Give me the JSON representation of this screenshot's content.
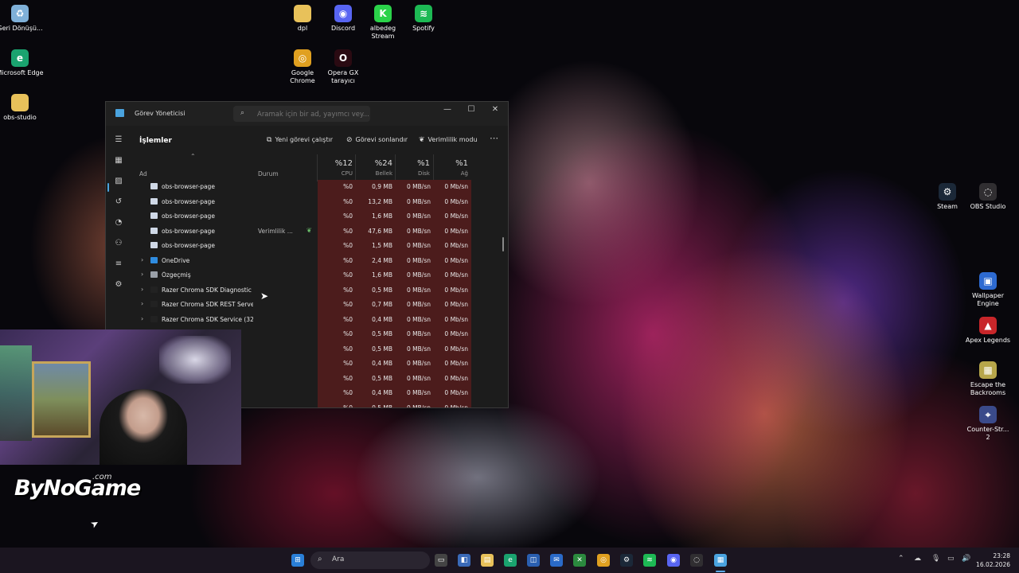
{
  "desktop": {
    "icons_left": [
      {
        "label": "Geri Dönüşü...",
        "icon": "recycle-bin-icon",
        "color": "#7fb0d8",
        "glyph": "♻"
      },
      {
        "label": "Microsoft Edge",
        "icon": "edge-icon",
        "color": "#1aa36f",
        "glyph": "e"
      },
      {
        "label": "obs-studio",
        "icon": "folder-icon",
        "color": "#e8c15a",
        "glyph": ""
      }
    ],
    "icons_top": [
      {
        "label": "dpl",
        "icon": "folder-icon",
        "color": "#e8c15a",
        "glyph": ""
      },
      {
        "label": "Discord",
        "icon": "discord-icon",
        "color": "#5865f2",
        "glyph": "◉"
      },
      {
        "label": "albedeg Stream",
        "icon": "kick-icon",
        "color": "#2bd34a",
        "glyph": "K"
      },
      {
        "label": "Spotify",
        "icon": "spotify-icon",
        "color": "#1db954",
        "glyph": "≋"
      },
      {
        "label": "Google Chrome",
        "icon": "chrome-icon",
        "color": "#e0a020",
        "glyph": "◎"
      },
      {
        "label": "Opera GX tarayıcı",
        "icon": "opera-gx-icon",
        "color": "#2a0a12",
        "glyph": "O"
      }
    ],
    "icons_right": [
      {
        "label": "Steam",
        "icon": "steam-icon",
        "color": "#1b2838",
        "glyph": "⚙"
      },
      {
        "label": "OBS Studio",
        "icon": "obs-icon",
        "color": "#302e31",
        "glyph": "◌"
      },
      {
        "label": "Wallpaper Engine",
        "icon": "wallpaper-engine-icon",
        "color": "#2d6ad1",
        "glyph": "▣"
      },
      {
        "label": "Apex Legends",
        "icon": "apex-icon",
        "color": "#c8262a",
        "glyph": "▲"
      },
      {
        "label": "Escape the Backrooms",
        "icon": "backrooms-icon",
        "color": "#b7a64a",
        "glyph": "▦"
      },
      {
        "label": "Counter-Str... 2",
        "icon": "cs2-icon",
        "color": "#3a4a8a",
        "glyph": "⌖"
      }
    ]
  },
  "task_manager": {
    "title": "Görev Yöneticisi",
    "search_placeholder": "Aramak için bir ad, yayımcı vey...",
    "page_title": "İşlemler",
    "toolbar": {
      "run_new_task": "Yeni görevi çalıştır",
      "end_task": "Görevi sonlandır",
      "efficiency_mode": "Verimlilik modu",
      "more": "⋯"
    },
    "columns": {
      "name": "Ad",
      "status": "Durum",
      "cpu_pct": "%12",
      "cpu": "CPU",
      "mem_pct": "%24",
      "mem": "Bellek",
      "disk_pct": "%1",
      "disk": "Disk",
      "net_pct": "%1",
      "net": "Ağ"
    },
    "rows": [
      {
        "name": "obs-browser-page",
        "expand": "",
        "status": "",
        "leaf": false,
        "cpu": "%0",
        "mem": "0,9 MB",
        "disk": "0 MB/sn",
        "net": "0 Mb/sn",
        "icon_color": "#cfd8e6"
      },
      {
        "name": "obs-browser-page",
        "expand": "",
        "status": "",
        "leaf": false,
        "cpu": "%0",
        "mem": "13,2 MB",
        "disk": "0 MB/sn",
        "net": "0 Mb/sn",
        "icon_color": "#cfd8e6"
      },
      {
        "name": "obs-browser-page",
        "expand": "",
        "status": "",
        "leaf": false,
        "cpu": "%0",
        "mem": "1,6 MB",
        "disk": "0 MB/sn",
        "net": "0 Mb/sn",
        "icon_color": "#cfd8e6"
      },
      {
        "name": "obs-browser-page",
        "expand": "",
        "status": "Verimlilik ...",
        "leaf": true,
        "cpu": "%0",
        "mem": "47,6 MB",
        "disk": "0 MB/sn",
        "net": "0 Mb/sn",
        "icon_color": "#cfd8e6"
      },
      {
        "name": "obs-browser-page",
        "expand": "",
        "status": "",
        "leaf": false,
        "cpu": "%0",
        "mem": "1,5 MB",
        "disk": "0 MB/sn",
        "net": "0 Mb/sn",
        "icon_color": "#cfd8e6"
      },
      {
        "name": "OneDrive",
        "expand": "›",
        "status": "",
        "leaf": false,
        "cpu": "%0",
        "mem": "2,4 MB",
        "disk": "0 MB/sn",
        "net": "0 Mb/sn",
        "icon_color": "#2f8ce0"
      },
      {
        "name": "Özgeçmiş",
        "expand": "›",
        "status": "",
        "leaf": false,
        "cpu": "%0",
        "mem": "1,6 MB",
        "disk": "0 MB/sn",
        "net": "0 Mb/sn",
        "icon_color": "#9aa0a8"
      },
      {
        "name": "Razer Chroma SDK Diagnostic ...",
        "expand": "›",
        "status": "",
        "leaf": false,
        "cpu": "%0",
        "mem": "0,5 MB",
        "disk": "0 MB/sn",
        "net": "0 Mb/sn",
        "icon_color": "#222"
      },
      {
        "name": "Razer Chroma SDK REST Serve...",
        "expand": "›",
        "status": "",
        "leaf": false,
        "cpu": "%0",
        "mem": "0,7 MB",
        "disk": "0 MB/sn",
        "net": "0 Mb/sn",
        "icon_color": "#222"
      },
      {
        "name": "Razer Chroma SDK Service (32 ...",
        "expand": "›",
        "status": "",
        "leaf": false,
        "cpu": "%0",
        "mem": "0,4 MB",
        "disk": "0 MB/sn",
        "net": "0 Mb/sn",
        "icon_color": "#222"
      },
      {
        "name": "",
        "expand": "",
        "status": "",
        "leaf": false,
        "cpu": "%0",
        "mem": "0,5 MB",
        "disk": "0 MB/sn",
        "net": "0 Mb/sn",
        "icon_color": "transparent"
      },
      {
        "name": "",
        "expand": "",
        "status": "",
        "leaf": false,
        "cpu": "%0",
        "mem": "0,5 MB",
        "disk": "0 MB/sn",
        "net": "0 Mb/sn",
        "icon_color": "transparent"
      },
      {
        "name": "",
        "expand": "",
        "status": "",
        "leaf": false,
        "cpu": "%0",
        "mem": "0,4 MB",
        "disk": "0 MB/sn",
        "net": "0 Mb/sn",
        "icon_color": "transparent"
      },
      {
        "name": "",
        "expand": "",
        "status": "",
        "leaf": false,
        "cpu": "%0",
        "mem": "0,5 MB",
        "disk": "0 MB/sn",
        "net": "0 Mb/sn",
        "icon_color": "transparent"
      },
      {
        "name": "",
        "expand": "",
        "status": "",
        "leaf": false,
        "cpu": "%0",
        "mem": "0,4 MB",
        "disk": "0 MB/sn",
        "net": "0 Mb/sn",
        "icon_color": "transparent"
      },
      {
        "name": "",
        "expand": "",
        "status": "",
        "leaf": false,
        "cpu": "%0",
        "mem": "0,5 MB",
        "disk": "0 MB/sn",
        "net": "0 Mb/sn",
        "icon_color": "transparent"
      }
    ]
  },
  "overlay": {
    "brand": "ByNoGame",
    "brand_suffix": ".com"
  },
  "taskbar": {
    "search_label": "Ara",
    "clock_time": "23:28",
    "clock_date": "16.02.2026"
  }
}
